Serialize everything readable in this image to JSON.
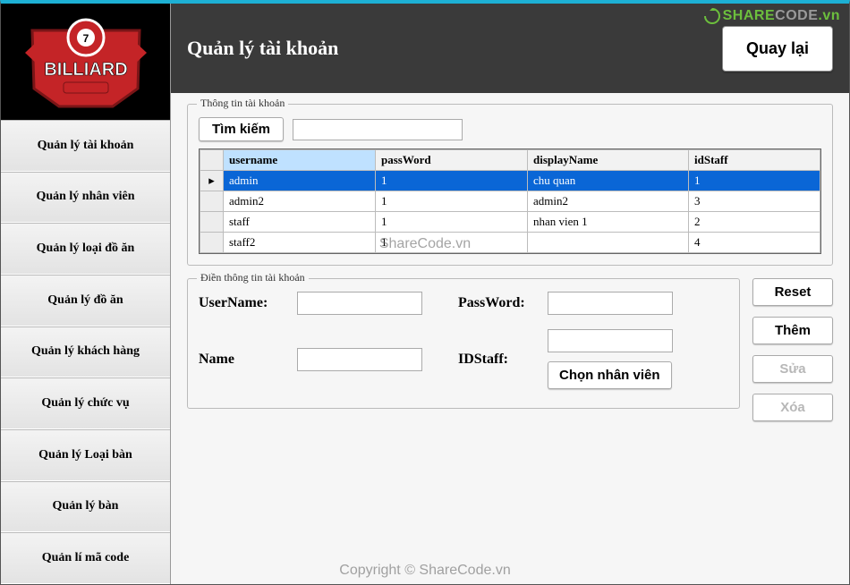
{
  "header": {
    "title": "Quản lý tài khoản",
    "back_label": "Quay lại"
  },
  "sidebar": {
    "items": [
      {
        "label": "Quản lý tài khoản"
      },
      {
        "label": "Quản lý nhân viên"
      },
      {
        "label": "Quản lý loại đồ ăn"
      },
      {
        "label": "Quản lý đồ ăn"
      },
      {
        "label": "Quản lý khách hàng"
      },
      {
        "label": "Quản lý chức vụ"
      },
      {
        "label": "Quản lý Loại bàn"
      },
      {
        "label": "Quản lý bàn"
      },
      {
        "label": "Quản lí mã code"
      }
    ]
  },
  "account_group": {
    "title": "Thông tin tài khoản",
    "search_button": "Tìm kiếm",
    "search_value": "",
    "columns": [
      "username",
      "passWord",
      "displayName",
      "idStaff"
    ],
    "rows": [
      {
        "username": "admin",
        "passWord": "1",
        "displayName": "chu quan",
        "idStaff": "1",
        "selected": true
      },
      {
        "username": "admin2",
        "passWord": "1",
        "displayName": "admin2",
        "idStaff": "3",
        "selected": false
      },
      {
        "username": "staff",
        "passWord": "1",
        "displayName": "nhan vien 1",
        "idStaff": "2",
        "selected": false
      },
      {
        "username": "staff2",
        "passWord": "1",
        "displayName": "",
        "idStaff": "4",
        "selected": false
      }
    ]
  },
  "form_group": {
    "title": "Điền thông tin tài khoản",
    "labels": {
      "username": "UserName:",
      "password": "PassWord:",
      "name": "Name",
      "idstaff": "IDStaff:",
      "choose": "Chọn nhân viên"
    },
    "values": {
      "username": "",
      "password": "",
      "name": "",
      "idstaff": ""
    }
  },
  "action_buttons": {
    "reset": "Reset",
    "add": "Thêm",
    "edit": "Sửa",
    "delete": "Xóa"
  },
  "watermark": {
    "mid": "ShareCode.vn",
    "bottom": "Copyright © ShareCode.vn",
    "top_brand_a": "SHARE",
    "top_brand_b": "CODE",
    "top_brand_c": ".vn"
  },
  "logo": {
    "text_line1": "BILLIARD",
    "text_line2": "7"
  }
}
